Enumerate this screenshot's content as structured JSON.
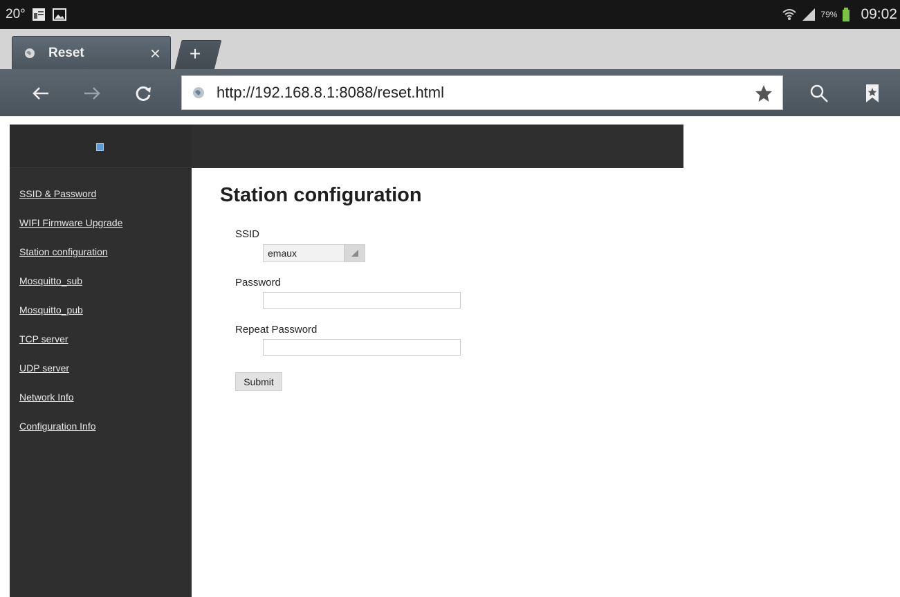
{
  "status_bar": {
    "temperature": "20°",
    "battery_percent": "79%",
    "time": "09:02"
  },
  "tab": {
    "title": "Reset",
    "close_glyph": "×",
    "new_tab_glyph": "+"
  },
  "toolbar": {
    "url": "http://192.168.8.1:8088/reset.html"
  },
  "sidebar": {
    "items": [
      {
        "label": "SSID & Password"
      },
      {
        "label": "WIFI Firmware Upgrade"
      },
      {
        "label": "Station configuration"
      },
      {
        "label": "Mosquitto_sub"
      },
      {
        "label": "Mosquitto_pub"
      },
      {
        "label": "TCP server"
      },
      {
        "label": "UDP server"
      },
      {
        "label": "Network Info"
      },
      {
        "label": "Configuration Info"
      }
    ]
  },
  "main": {
    "title": "Station configuration",
    "ssid_label": "SSID",
    "ssid_value": "emaux",
    "password_label": "Password",
    "password_value": "",
    "repeat_password_label": "Repeat Password",
    "repeat_password_value": "",
    "submit_label": "Submit"
  },
  "icons": {
    "back": "back-arrow-icon",
    "forward": "forward-arrow-icon",
    "reload": "reload-icon",
    "bookmark_star": "star-icon",
    "search": "search-icon",
    "bookmarks": "bookmarks-icon"
  }
}
